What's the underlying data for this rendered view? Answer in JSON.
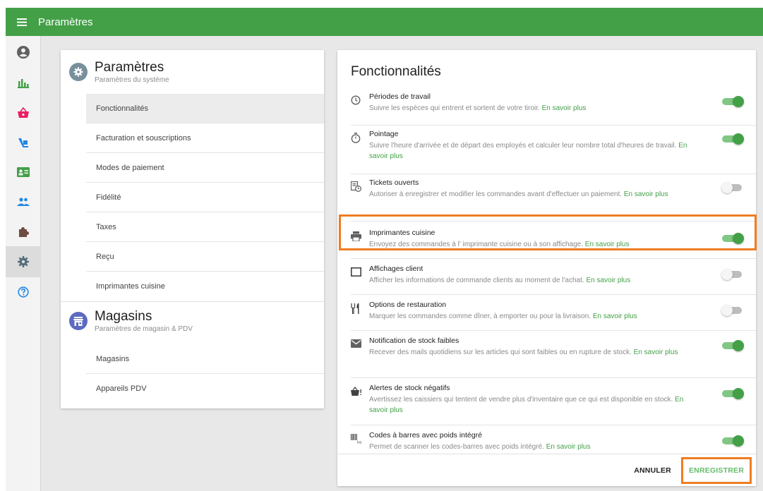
{
  "topbar": {
    "title": "Paramètres"
  },
  "sidenav": {
    "items": [
      {
        "icon": "account-icon",
        "color": "#616161"
      },
      {
        "icon": "reports-icon",
        "color": "#43a047"
      },
      {
        "icon": "basket-icon",
        "color": "#e91e63"
      },
      {
        "icon": "items-icon",
        "color": "#1e88e5"
      },
      {
        "icon": "employee-card-icon",
        "color": "#43a047"
      },
      {
        "icon": "customers-icon",
        "color": "#1e88e5"
      },
      {
        "icon": "integrations-icon",
        "color": "#6d4c41"
      },
      {
        "icon": "settings-icon",
        "color": "#546e7a"
      },
      {
        "icon": "help-icon",
        "color": "#1e88e5"
      }
    ]
  },
  "left": {
    "system": {
      "title": "Paramètres",
      "subtitle": "Paramètres du système",
      "items": [
        "Fonctionnalités",
        "Facturation et souscriptions",
        "Modes de paiement",
        "Fidélité",
        "Taxes",
        "Reçu",
        "Imprimantes cuisine"
      ]
    },
    "stores": {
      "title": "Magasins",
      "subtitle": "Paramètres de magasin & PDV",
      "items": [
        "Magasins",
        "Appareils PDV"
      ]
    }
  },
  "features": {
    "title": "Fonctionnalités",
    "more": "En savoir plus",
    "items": [
      {
        "name": "Périodes de travail",
        "desc": "Suivre les espèces qui entrent et sortent de votre tiroir.",
        "enabled": true,
        "icon": "clock-icon"
      },
      {
        "name": "Pointage",
        "desc": "Suivre l'heure d'arrivée et de départ des employés et calculer leur nombre total d'heures de travail.",
        "enabled": true,
        "icon": "stopwatch-icon"
      },
      {
        "name": "Tickets ouverts",
        "desc": "Autoriser à enregistrer et modifier les commandes avant d'effectuer un paiement.",
        "enabled": false,
        "icon": "open-ticket-icon"
      },
      {
        "name": "Imprimantes cuisine",
        "desc": "Envoyez des commandes à l' imprimante cuisine ou à son affichage.",
        "enabled": true,
        "icon": "printer-icon"
      },
      {
        "name": "Affichages client",
        "desc": "Afficher les informations de commande clients au moment de l'achat.",
        "enabled": false,
        "icon": "display-icon"
      },
      {
        "name": "Options de restauration",
        "desc": "Marquer les commandes comme dîner, à emporter ou pour la livraison.",
        "enabled": false,
        "icon": "utensils-icon"
      },
      {
        "name": "Notification de stock faibles",
        "desc": "Recever des mails quotidiens sur les articles qui sont faibles ou en rupture de stock.",
        "enabled": true,
        "icon": "mail-icon"
      },
      {
        "name": "Alertes de stock négatifs",
        "desc": "Avertissez les caissiers qui tentent de vendre plus d'inventaire que ce qui est disponible en stock.",
        "enabled": true,
        "icon": "basket-alert-icon"
      },
      {
        "name": "Codes à barres avec poids intégré",
        "desc": "Permet de scanner les codes-barres avec poids intégré.",
        "enabled": true,
        "icon": "barcode-kg-icon"
      }
    ]
  },
  "footer": {
    "cancel": "ANNULER",
    "save": "ENREGISTRER"
  },
  "colors": {
    "primary": "#43a047",
    "accent_outline": "#ef7d22"
  }
}
